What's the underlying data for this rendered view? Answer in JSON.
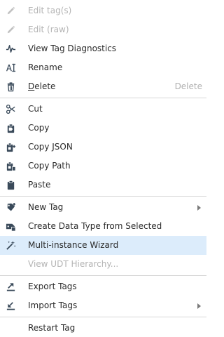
{
  "menu": {
    "items": [
      {
        "label": "Edit tag(s)",
        "icon": "pencil-icon",
        "disabled": true
      },
      {
        "label": "Edit (raw)",
        "icon": "pencil-icon",
        "disabled": true
      },
      {
        "label": "View Tag Diagnostics",
        "icon": "diagnostics-icon"
      },
      {
        "label": "Rename",
        "icon": "rename-icon"
      },
      {
        "label": "Delete",
        "icon": "trash-icon",
        "shortcut": "Delete"
      },
      {
        "label": "Cut",
        "icon": "scissors-icon"
      },
      {
        "label": "Copy",
        "icon": "copy-tag-icon"
      },
      {
        "label": "Copy JSON",
        "icon": "copy-json-icon"
      },
      {
        "label": "Copy Path",
        "icon": "copy-path-icon"
      },
      {
        "label": "Paste",
        "icon": "clipboard-icon"
      },
      {
        "label": "New Tag",
        "icon": "new-tag-icon",
        "submenu": true
      },
      {
        "label": "Create Data Type from Selected",
        "icon": "create-data-type-icon"
      },
      {
        "label": "Multi-instance Wizard",
        "icon": "wizard-icon",
        "highlighted": true
      },
      {
        "label": "View UDT Hierarchy...",
        "icon": "none",
        "disabled": true
      },
      {
        "label": "Export Tags",
        "icon": "export-icon"
      },
      {
        "label": "Import Tags",
        "icon": "import-icon",
        "submenu": true
      },
      {
        "label": "Restart Tag",
        "icon": "none"
      }
    ]
  },
  "colors": {
    "highlight": "#dcecfb",
    "disabled_text": "#b4b4b4",
    "icon": "#3a4a5a",
    "separator": "#d6d6d6"
  }
}
